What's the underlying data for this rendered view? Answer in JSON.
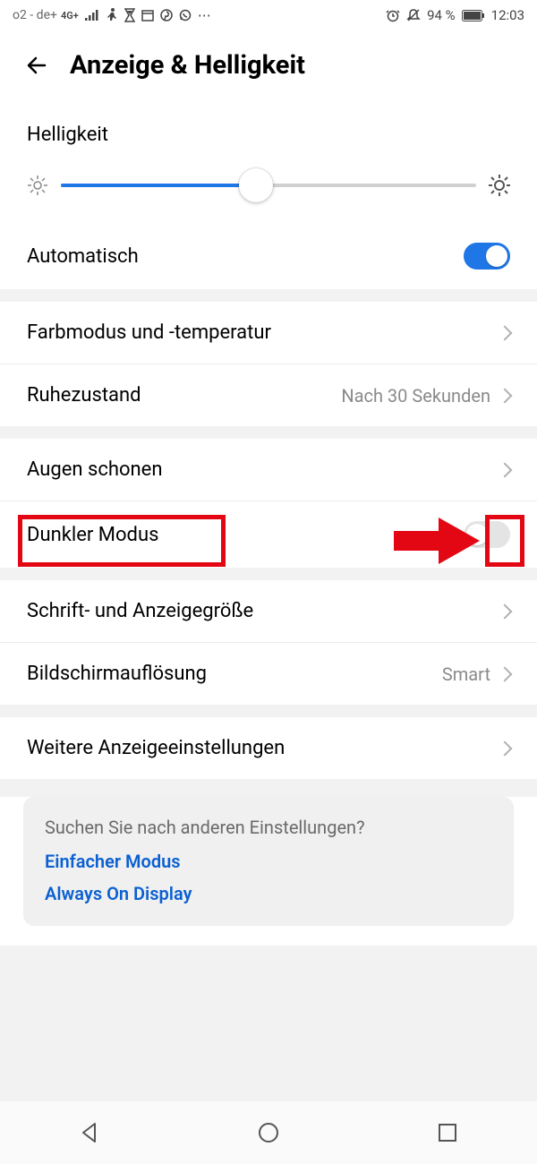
{
  "statusbar": {
    "carrier": "o2 - de+",
    "network": "4G+",
    "battery": "94 %",
    "time": "12:03"
  },
  "header": {
    "title": "Anzeige & Helligkeit"
  },
  "brightness": {
    "section_label": "Helligkeit",
    "auto_label": "Automatisch",
    "auto_on": true,
    "slider_percent": 47
  },
  "rows": {
    "color_mode": "Farbmodus und -temperatur",
    "sleep": {
      "label": "Ruhezustand",
      "value": "Nach 30 Sekunden"
    },
    "eye_comfort": "Augen schonen",
    "dark_mode": {
      "label": "Dunkler Modus",
      "on": false
    },
    "font_size": "Schrift- und Anzeigegröße",
    "resolution": {
      "label": "Bildschirmauflösung",
      "value": "Smart"
    },
    "more": "Weitere Anzeigeeinstellungen"
  },
  "search_card": {
    "question": "Suchen Sie nach anderen Einstellungen?",
    "link1": "Einfacher Modus",
    "link2": "Always On Display"
  }
}
